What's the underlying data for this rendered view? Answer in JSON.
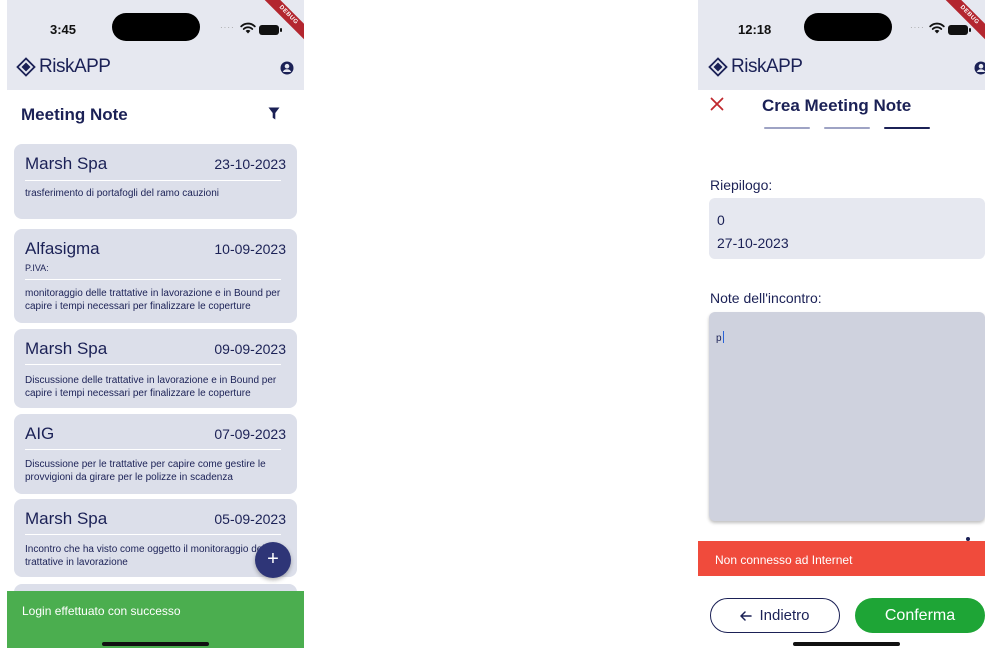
{
  "left_screen": {
    "status_time": "3:45",
    "debug_label": "DEBUG",
    "app_name": "RiskAPP",
    "list_title": "Meeting Note",
    "notes": [
      {
        "name": "Marsh Spa",
        "date": "23-10-2023",
        "piva": "",
        "description": "trasferimento di portafogli del ramo cauzioni"
      },
      {
        "name": "Alfasigma",
        "date": "10-09-2023",
        "piva": "P.IVA:",
        "description": "monitoraggio delle trattative in lavorazione e in Bound per capire i tempi necessari per finalizzare le coperture"
      },
      {
        "name": "Marsh Spa",
        "date": "09-09-2023",
        "piva": "",
        "description": "Discussione delle trattative in lavorazione e in Bound per capire i tempi necessari per finalizzare le coperture"
      },
      {
        "name": "AIG",
        "date": "07-09-2023",
        "piva": "",
        "description": "Discussione per le trattative per capire come gestire le provvigioni da girare per le polizze in scadenza"
      },
      {
        "name": "Marsh Spa",
        "date": "05-09-2023",
        "piva": "",
        "description": "Incontro che ha visto come oggetto il monitoraggio delle trattative in lavorazione"
      }
    ],
    "fab_label": "+",
    "snackbar": "Login effettuato con successo"
  },
  "right_screen": {
    "status_time": "12:18",
    "debug_label": "DEBUG",
    "app_name": "RiskAPP",
    "title": "Crea Meeting Note",
    "steps_total": 3,
    "current_step": 3,
    "summary_label": "Riepilogo:",
    "summary_lines": [
      "0",
      "27-10-2023"
    ],
    "notes_label": "Note dell'incontro:",
    "notes_value": "p",
    "snackbar": "Non connesso ad Internet",
    "back_button": "Indietro",
    "confirm_button": "Conferma"
  },
  "colors": {
    "primary": "#1b2156",
    "bar_background": "#e6e8f0",
    "card_background": "#dcdfea",
    "fab": "#2e3577",
    "success": "#4bae4f",
    "error": "#f04b3c",
    "confirm": "#1ea536",
    "debug_ribbon": "#b3262f"
  }
}
